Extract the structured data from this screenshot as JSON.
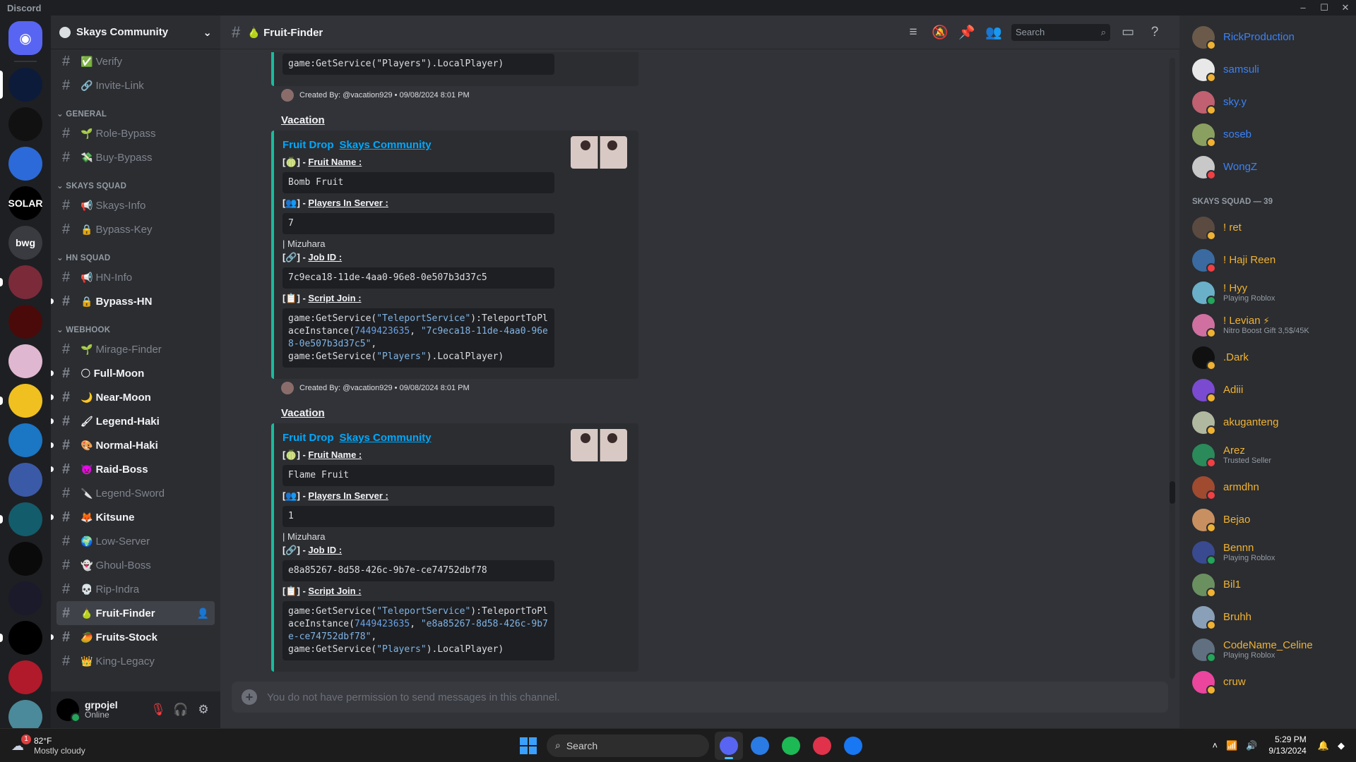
{
  "window": {
    "title": "Discord",
    "controls": [
      "–",
      "☐",
      "✕"
    ]
  },
  "servers": [
    {
      "label": "",
      "color": "#5865f2",
      "kind": "home"
    },
    {
      "label": "",
      "color": "#0d1b3a"
    },
    {
      "label": "",
      "color": "#111111"
    },
    {
      "label": "",
      "color": "#2b6ad8"
    },
    {
      "label": "SOLAR",
      "color": "#000000"
    },
    {
      "label": "bwg",
      "color": "#3a3b40"
    },
    {
      "label": "",
      "color": "#7b2a3a"
    },
    {
      "label": "",
      "color": "#4a0a0a"
    },
    {
      "label": "",
      "color": "#e0b7d0"
    },
    {
      "label": "",
      "color": "#f0c020"
    },
    {
      "label": "",
      "color": "#1b76c4"
    },
    {
      "label": "",
      "color": "#3a5aa8"
    },
    {
      "label": "",
      "color": "#135c6b"
    },
    {
      "label": "",
      "color": "#0a0a0a"
    },
    {
      "label": "",
      "color": "#1a1a2a"
    },
    {
      "label": "",
      "color": "#000000"
    },
    {
      "label": "",
      "color": "#b01a2a"
    },
    {
      "label": "",
      "color": "#4a8a9a"
    }
  ],
  "guild": {
    "name": "Skays Community"
  },
  "channels_pre": [
    {
      "name": "Verify",
      "emoji": "✅",
      "state": "normal"
    },
    {
      "name": "Invite-Link",
      "emoji": "🔗",
      "state": "normal"
    }
  ],
  "categories": [
    {
      "name": "GENERAL",
      "channels": [
        {
          "name": "Role-Bypass",
          "emoji": "🌱",
          "state": "normal"
        },
        {
          "name": "Buy-Bypass",
          "emoji": "💸",
          "state": "normal"
        }
      ]
    },
    {
      "name": "SKAYS SQUAD",
      "channels": [
        {
          "name": "Skays-Info",
          "emoji": "📢",
          "state": "normal"
        },
        {
          "name": "Bypass-Key",
          "emoji": "🔒",
          "state": "normal"
        }
      ]
    },
    {
      "name": "HN SQUAD",
      "channels": [
        {
          "name": "HN-Info",
          "emoji": "📢",
          "state": "normal"
        },
        {
          "name": "Bypass-HN",
          "emoji": "🔒",
          "state": "unread"
        }
      ]
    },
    {
      "name": "WEBHOOK",
      "channels": [
        {
          "name": "Mirage-Finder",
          "emoji": "🌱",
          "state": "normal"
        },
        {
          "name": "Full-Moon",
          "emoji": "🌕",
          "state": "unread"
        },
        {
          "name": "Near-Moon",
          "emoji": "🌙",
          "state": "unread"
        },
        {
          "name": "Legend-Haki",
          "emoji": "🖌",
          "state": "unread"
        },
        {
          "name": "Normal-Haki",
          "emoji": "🎨",
          "state": "unread"
        },
        {
          "name": "Raid-Boss",
          "emoji": "👿",
          "state": "unread"
        },
        {
          "name": "Legend-Sword",
          "emoji": "🔪",
          "state": "normal"
        },
        {
          "name": "Kitsune",
          "emoji": "🦊",
          "state": "unread"
        },
        {
          "name": "Low-Server",
          "emoji": "🌍",
          "state": "normal"
        },
        {
          "name": "Ghoul-Boss",
          "emoji": "👻",
          "state": "normal"
        },
        {
          "name": "Rip-Indra",
          "emoji": "💀",
          "state": "normal"
        },
        {
          "name": "Fruit-Finder",
          "emoji": "🍐",
          "state": "selected"
        },
        {
          "name": "Fruits-Stock",
          "emoji": "🥭",
          "state": "unread"
        },
        {
          "name": "King-Legacy",
          "emoji": "👑",
          "state": "normal"
        }
      ]
    }
  ],
  "user": {
    "name": "grpojel",
    "status": "Online"
  },
  "header": {
    "channel": "Fruit-Finder",
    "search_placeholder": "Search"
  },
  "messages": {
    "top_code_tail": "game:GetService(\"Players\").LocalPlayer)",
    "top_created": "Created By: @vacation929 • 09/08/2024 8:01 PM",
    "embed_labels": {
      "fruit_name": "Fruit Name :",
      "players": "Players In Server :",
      "job_id": "Job ID :",
      "script": "Script Join :",
      "bracket_open": "[",
      "bracket_close": "] - "
    },
    "items": [
      {
        "author": "Vacation",
        "embed_title": "Fruit Drop",
        "embed_link": "Skays Community",
        "fruit": "Bomb Fruit",
        "players": "7",
        "note": "| Mizuhara",
        "job_id": "7c9eca18-11de-4aa0-96e8-0e507b3d37c5",
        "script_parts": [
          "game:GetService(",
          "\"TeleportService\"",
          "):TeleportToPlaceInstance(",
          "7449423635",
          ", ",
          "\"7c9eca18-11de-4aa0-96e8-0e507b3d37c5\"",
          ",\ngame:GetService(",
          "\"Players\"",
          ").LocalPlayer)"
        ],
        "created": "Created By: @vacation929 • 09/08/2024 8:01 PM"
      },
      {
        "author": "Vacation",
        "embed_title": "Fruit Drop",
        "embed_link": "Skays Community",
        "fruit": "Flame Fruit",
        "players": "1",
        "note": "| Mizuhara",
        "job_id": "e8a85267-8d58-426c-9b7e-ce74752dbf78",
        "script_parts": [
          "game:GetService(",
          "\"TeleportService\"",
          "):TeleportToPlaceInstance(",
          "7449423635",
          ", ",
          "\"e8a85267-8d58-426c-9b7e-ce74752dbf78\"",
          ",\ngame:GetService(",
          "\"Players\"",
          ").LocalPlayer)"
        ],
        "created": ""
      }
    ]
  },
  "composer": {
    "placeholder": "You do not have permission to send messages in this channel."
  },
  "members": {
    "top": [
      {
        "name": "RickProduction",
        "color": "#3b82f6",
        "avatar": "#6b5a4a",
        "status": "#f0b232"
      },
      {
        "name": "samsuli",
        "color": "#3b82f6",
        "avatar": "#e8e8e8",
        "status": "#f0b232"
      },
      {
        "name": "sky.y",
        "color": "#3b82f6",
        "avatar": "#c06070",
        "status": "#f0b232"
      },
      {
        "name": "soseb",
        "color": "#3b82f6",
        "avatar": "#8aa060",
        "status": "#f0b232"
      },
      {
        "name": "WongZ",
        "color": "#3b82f6",
        "avatar": "#c8c8c8",
        "status": "#f23f43"
      }
    ],
    "category": "SKAYS SQUAD — 39",
    "squad": [
      {
        "name": "! ret",
        "sub": "",
        "color": "#f0b232",
        "avatar": "#5a4a40",
        "status": "#f0b232"
      },
      {
        "name": "! Haji Reen",
        "sub": "",
        "color": "#f0b232",
        "avatar": "#3a6aa0",
        "status": "#f23f43"
      },
      {
        "name": "! Hyy",
        "sub": "Playing Roblox",
        "color": "#f0b232",
        "avatar": "#6ab0c8",
        "status": "#23a55a"
      },
      {
        "name": "! Levian",
        "sub": "Nitro Boost Gift 3,5$/45K",
        "color": "#f0b232",
        "avatar": "#d070a0",
        "status": "#f0b232",
        "bolt": "⚡"
      },
      {
        "name": ".Dark",
        "sub": "",
        "color": "#f0b232",
        "avatar": "#101010",
        "status": "#f0b232"
      },
      {
        "name": "Adiii",
        "sub": "",
        "color": "#f0b232",
        "avatar": "#7a4ad0",
        "status": "#f0b232"
      },
      {
        "name": "akuganteng",
        "sub": "",
        "color": "#f0b232",
        "avatar": "#b0b8a0",
        "status": "#f0b232"
      },
      {
        "name": "Arez",
        "sub": "Trusted Seller",
        "color": "#f0b232",
        "avatar": "#2a8a5a",
        "status": "#f23f43"
      },
      {
        "name": "armdhn",
        "sub": "",
        "color": "#f0b232",
        "avatar": "#a04a30",
        "status": "#f23f43"
      },
      {
        "name": "Bejao",
        "sub": "",
        "color": "#f0b232",
        "avatar": "#c89060",
        "status": "#f0b232"
      },
      {
        "name": "Bennn",
        "sub": "Playing Roblox",
        "color": "#f0b232",
        "avatar": "#3a4a90",
        "status": "#23a55a"
      },
      {
        "name": "Bil1",
        "sub": "",
        "color": "#f0b232",
        "avatar": "#6a9060",
        "status": "#f0b232"
      },
      {
        "name": "Bruhh",
        "sub": "",
        "color": "#f0b232",
        "avatar": "#8aa0b8",
        "status": "#f0b232"
      },
      {
        "name": "CodeName_Celine",
        "sub": "Playing Roblox",
        "color": "#f0b232",
        "avatar": "#607080",
        "status": "#23a55a"
      },
      {
        "name": "cruw",
        "sub": "",
        "color": "#f0b232",
        "avatar": "#eb459e",
        "status": "#f0b232"
      }
    ]
  },
  "taskbar": {
    "badge": "1",
    "temp": "82°F",
    "condition": "Mostly cloudy",
    "search": "Search",
    "time": "5:29 PM",
    "date": "9/13/2024",
    "apps": [
      {
        "name": "discord",
        "color": "#5865f2",
        "active": true
      },
      {
        "name": "messaging",
        "color": "#2a7be4",
        "active": false
      },
      {
        "name": "spotify",
        "color": "#1db954",
        "active": false
      },
      {
        "name": "opera",
        "color": "#e0324b",
        "active": false
      },
      {
        "name": "messenger",
        "color": "#1877f2",
        "active": false
      }
    ]
  }
}
